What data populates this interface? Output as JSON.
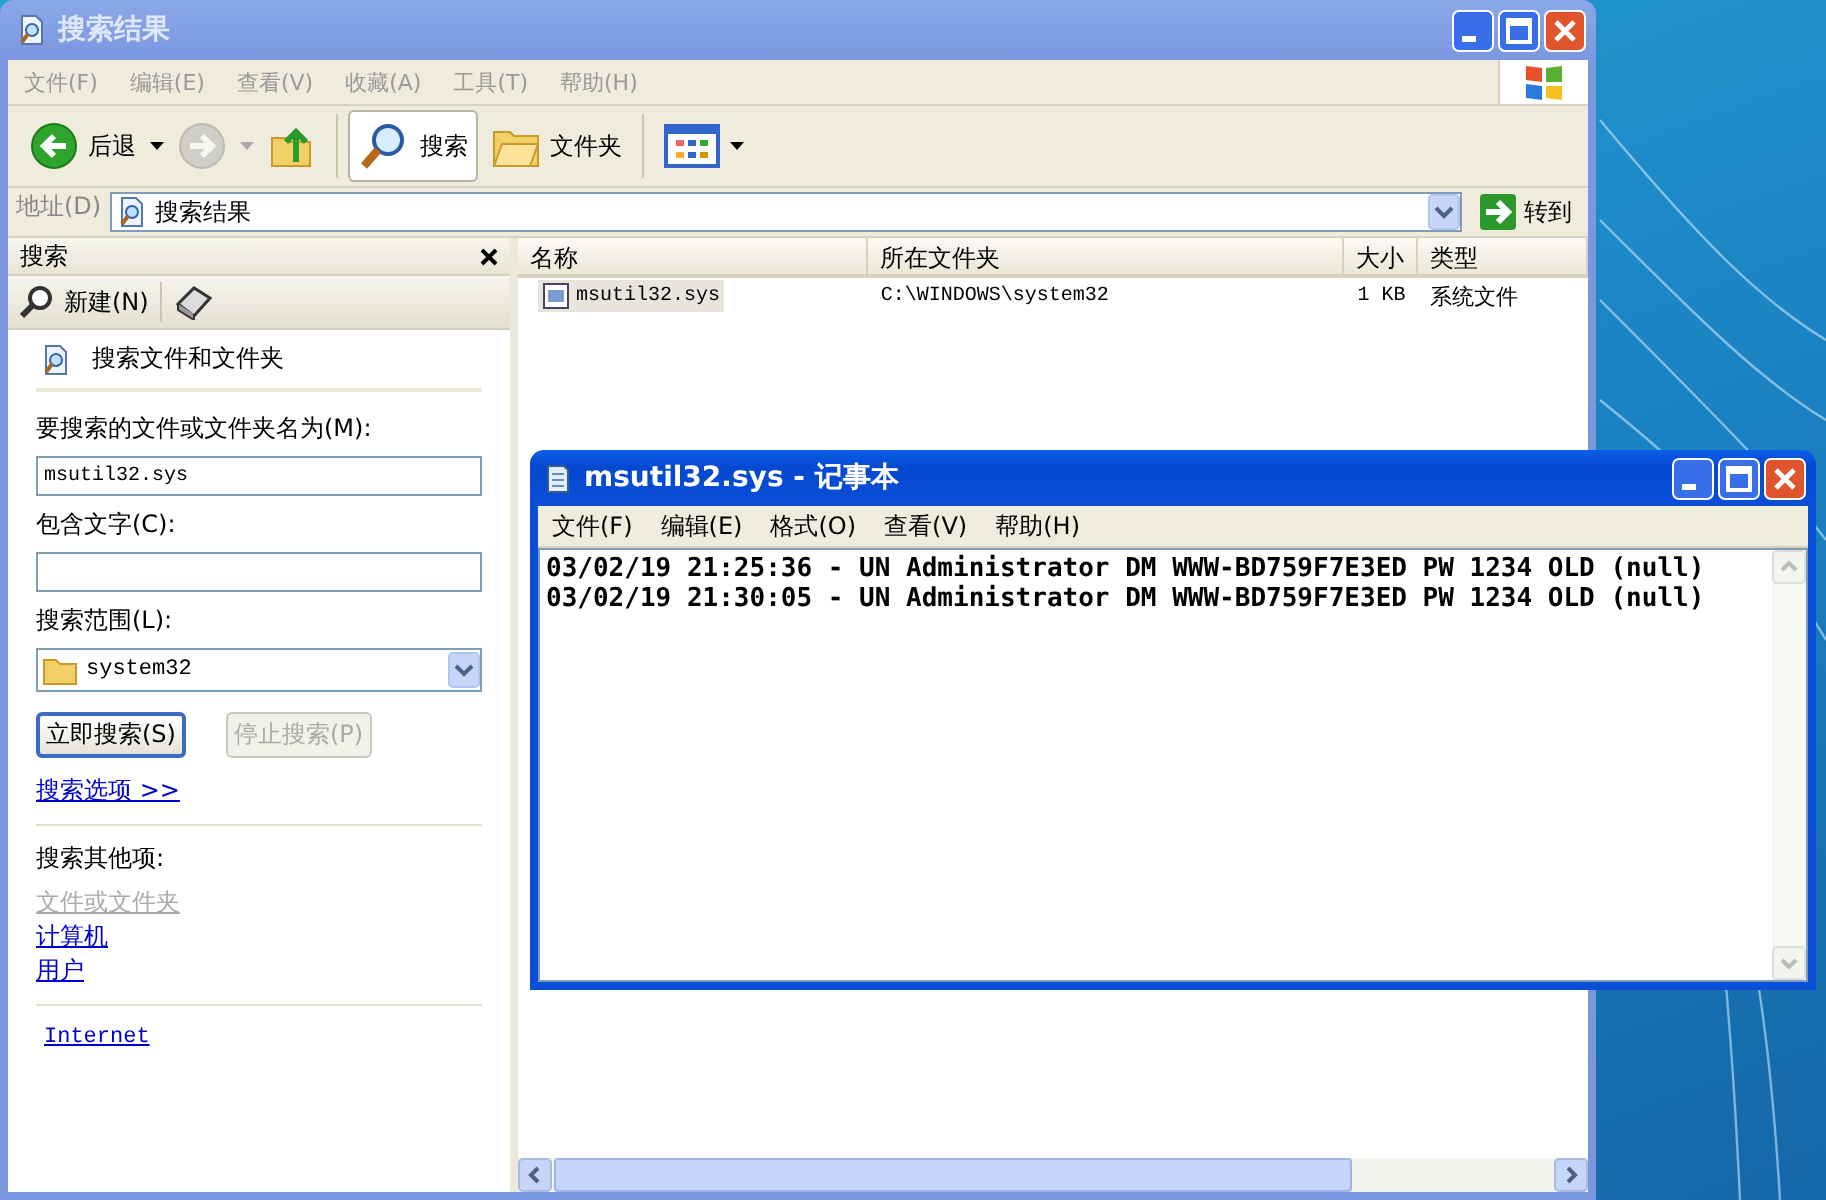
{
  "explorer": {
    "title": "搜索结果",
    "active": false,
    "menu": [
      "文件(F)",
      "编辑(E)",
      "查看(V)",
      "收藏(A)",
      "工具(T)",
      "帮助(H)"
    ],
    "toolbar": [
      {
        "kind": "back",
        "label": "后退",
        "disabled": false
      },
      {
        "kind": "forward",
        "disabled": true
      },
      {
        "kind": "up",
        "disabled": false
      },
      {
        "kind": "separator"
      },
      {
        "kind": "search",
        "label": "搜索",
        "selected": true
      },
      {
        "kind": "folders",
        "label": "文件夹",
        "selected": false
      },
      {
        "kind": "separator"
      },
      {
        "kind": "views"
      }
    ],
    "address": {
      "label": "地址(D)",
      "value": "搜索结果",
      "go": "转到"
    },
    "search_pane": {
      "title": "搜索",
      "new": "新建(N)",
      "heading": "搜索文件和文件夹",
      "name_label": "要搜索的文件或文件夹名为(M):",
      "name_value": "msutil32.sys",
      "text_label": "包含文字(C):",
      "scope_label": "搜索范围(L):",
      "scope_value": "system32",
      "buttons": [
        {
          "label": "立即搜索(S)",
          "disabled": false
        },
        {
          "label": "停止搜索(P)",
          "disabled": true
        }
      ],
      "options_link": "搜索选项 >>",
      "other_heading": "搜索其他项:",
      "other_links": [
        {
          "label": "文件或文件夹",
          "disabled": true
        },
        {
          "label": "计算机",
          "disabled": false
        },
        {
          "label": "用户",
          "disabled": false
        }
      ],
      "internet_link": "Internet"
    },
    "results": {
      "columns": [
        "名称",
        "所在文件夹",
        "大小",
        "类型"
      ],
      "rows": [
        {
          "cells": [
            "msutil32.sys",
            "C:\\WINDOWS\\system32",
            "1 KB",
            "系统文件"
          ],
          "selected": true
        }
      ]
    }
  },
  "notepad": {
    "title": "msutil32.sys - 记事本",
    "active": true,
    "menu": [
      "文件(F)",
      "编辑(E)",
      "格式(O)",
      "查看(V)",
      "帮助(H)"
    ],
    "lines": [
      "03/02/19 21:25:36 - UN Administrator DM WWW-BD759F7E3ED PW 1234 OLD (null)",
      "03/02/19 21:30:05 - UN Administrator DM WWW-BD759F7E3ED PW 1234 OLD (null)"
    ]
  }
}
